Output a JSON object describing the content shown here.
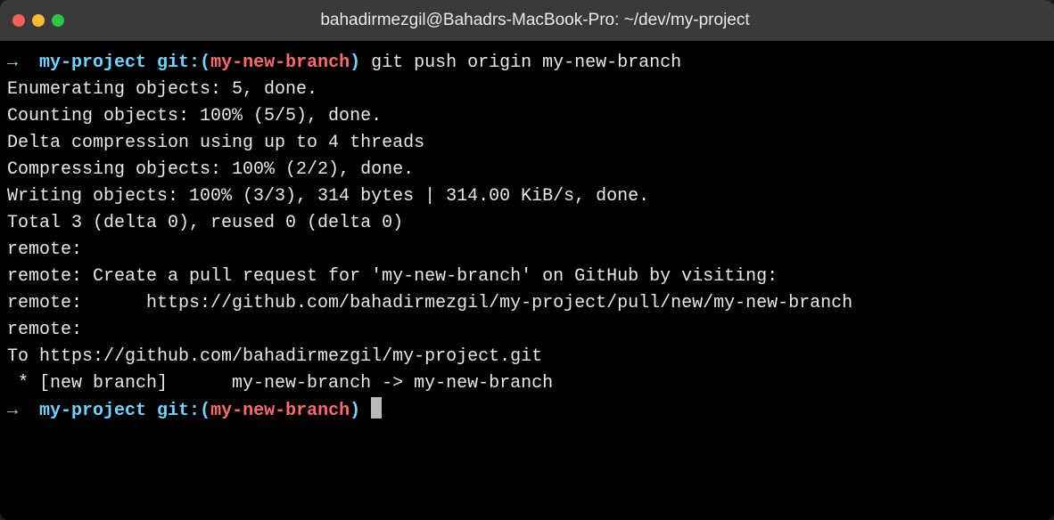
{
  "window": {
    "title": "bahadirmezgil@Bahadrs-MacBook-Pro: ~/dev/my-project"
  },
  "prompt1": {
    "arrow": "→  ",
    "dir": "my-project ",
    "git_label": "git:",
    "paren_open": "(",
    "branch": "my-new-branch",
    "paren_close": ")",
    "command": " git push origin my-new-branch"
  },
  "output": {
    "line1": "Enumerating objects: 5, done.",
    "line2": "Counting objects: 100% (5/5), done.",
    "line3": "Delta compression using up to 4 threads",
    "line4": "Compressing objects: 100% (2/2), done.",
    "line5": "Writing objects: 100% (3/3), 314 bytes | 314.00 KiB/s, done.",
    "line6": "Total 3 (delta 0), reused 0 (delta 0)",
    "line7": "remote: ",
    "line8": "remote: Create a pull request for 'my-new-branch' on GitHub by visiting:",
    "line9": "remote:      https://github.com/bahadirmezgil/my-project/pull/new/my-new-branch",
    "line10": "remote: ",
    "line11": "To https://github.com/bahadirmezgil/my-project.git",
    "line12": " * [new branch]      my-new-branch -> my-new-branch"
  },
  "prompt2": {
    "arrow": "→  ",
    "dir": "my-project ",
    "git_label": "git:",
    "paren_open": "(",
    "branch": "my-new-branch",
    "paren_close": ")",
    "space": " "
  }
}
